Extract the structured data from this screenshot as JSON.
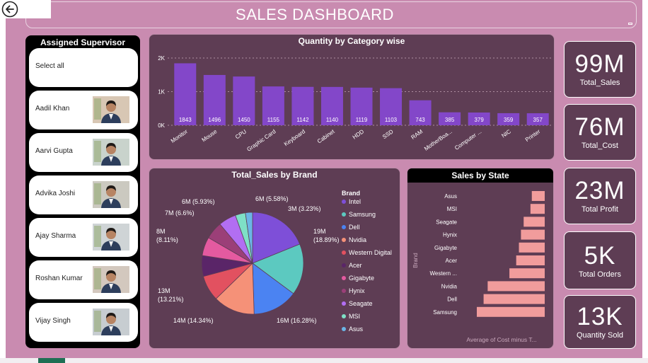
{
  "header": {
    "title": "SALES DASHBOARD"
  },
  "supervisors": {
    "title": "Assigned Supervisor",
    "items": [
      {
        "label": "Select all"
      },
      {
        "label": "Aadil Khan"
      },
      {
        "label": "Aarvi Gupta"
      },
      {
        "label": "Advika Joshi"
      },
      {
        "label": "Ajay Sharma"
      },
      {
        "label": "Roshan Kumar"
      },
      {
        "label": "Vijay Singh"
      }
    ]
  },
  "kpis": [
    {
      "value": "99M",
      "label": "Total_Sales"
    },
    {
      "value": "76M",
      "label": "Total_Cost"
    },
    {
      "value": "23M",
      "label": "Total Profit"
    },
    {
      "value": "5K",
      "label": "Total Orders"
    },
    {
      "value": "13K",
      "label": "Quantity Sold"
    }
  ],
  "colors": {
    "background": "#c98bb0",
    "panel": "#5e3d54",
    "bar": "#8347c9",
    "state_bar": "#f19c9c"
  },
  "chart_data": [
    {
      "type": "bar",
      "title": "Quantity by Category wise",
      "categories": [
        "Monitor",
        "Mouse",
        "CPU",
        "Graphic Card",
        "Keyboard",
        "Cabinet",
        "HDD",
        "SSD",
        "RAM",
        "MotherBoa...",
        "Computer ...",
        "NIC",
        "Printer"
      ],
      "values": [
        1843,
        1496,
        1450,
        1155,
        1142,
        1140,
        1119,
        1103,
        743,
        385,
        379,
        359,
        357
      ],
      "ylim": [
        0,
        2000
      ],
      "yticks": [
        "0K",
        "1K",
        "2K"
      ],
      "grid": true
    },
    {
      "type": "pie",
      "title": "Total_Sales by Brand",
      "legend_title": "Brand",
      "legend_position": "right",
      "slices": [
        {
          "label": "Intel",
          "value": 18.89,
          "display": "19M\n(18.89%)",
          "color": "#7e4fd8"
        },
        {
          "label": "Samsung",
          "value": 16.28,
          "display": "16M (16.28%)",
          "color": "#5cc9c0"
        },
        {
          "label": "Dell",
          "value": 14.34,
          "display": "14M (14.34%)",
          "color": "#4b83f2"
        },
        {
          "label": "Nvidia",
          "value": 13.21,
          "display": "13M\n(13.21%)",
          "color": "#f59178"
        },
        {
          "label": "Western Digital",
          "value": 8.11,
          "display": "8M\n(8.11%)",
          "color": "#e25160"
        },
        {
          "label": "Acer",
          "value": 6.6,
          "display": "7M (6.6%)",
          "color": "#5a2568"
        },
        {
          "label": "Gigabyte",
          "value": 5.93,
          "display": "6M (5.93%)",
          "color": "#e45aa0"
        },
        {
          "label": "Hynix",
          "value": 5.58,
          "display": "6M (5.58%)",
          "color": "#9b3f78"
        },
        {
          "label": "Seagate",
          "value": 5.58,
          "display": "",
          "color": "#b26ef2"
        },
        {
          "label": "MSI",
          "value": 3.23,
          "display": "3M (3.23%)",
          "color": "#7ee0c6"
        },
        {
          "label": "Asus",
          "value": 2.25,
          "display": "",
          "color": "#6bb5e6"
        }
      ]
    },
    {
      "type": "bar",
      "orientation": "horizontal",
      "title": "Sales by State",
      "ylabel": "Brand",
      "xlabel": "Average of Cost minus T...",
      "categories": [
        "Asus",
        "MSI",
        "Seagate",
        "Hynix",
        "Gigabyte",
        "Acer",
        "Western ...",
        "Nvidia",
        "Dell",
        "Samsung"
      ],
      "values": [
        0.19,
        0.21,
        0.31,
        0.35,
        0.38,
        0.42,
        0.52,
        0.84,
        0.9,
        1.0
      ]
    }
  ]
}
